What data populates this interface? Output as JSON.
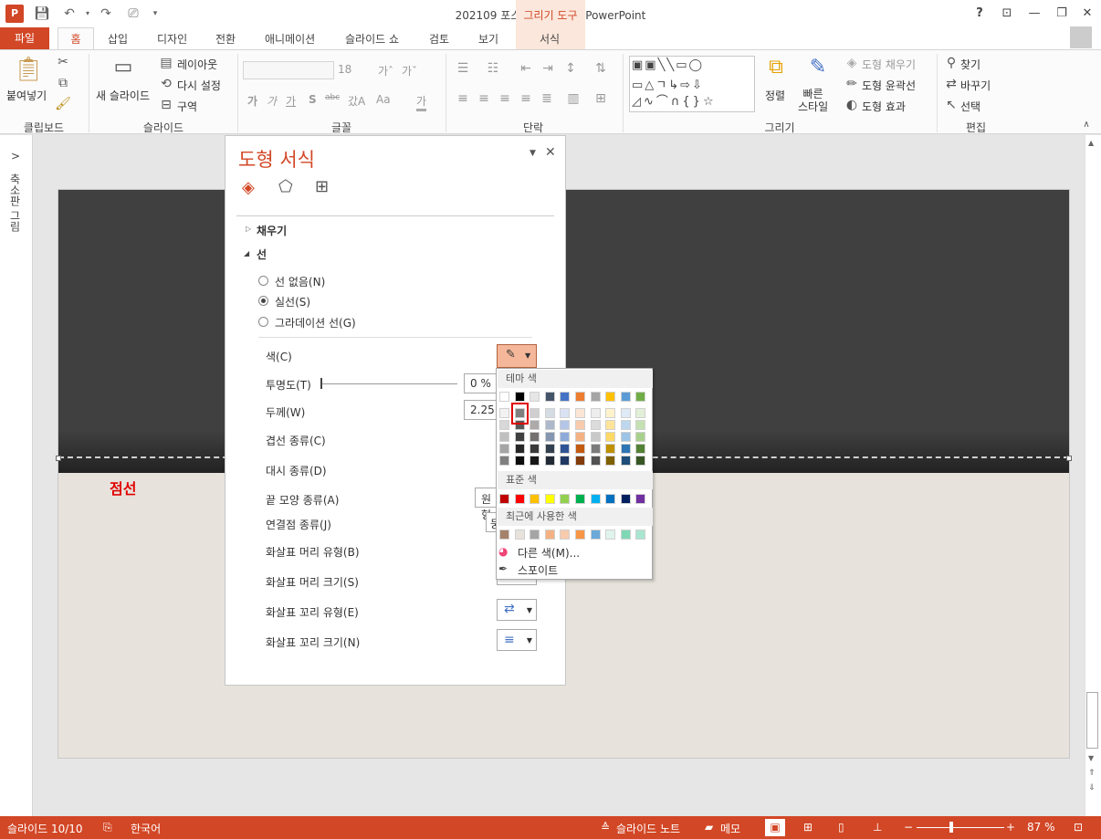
{
  "window": {
    "title": "202109 포스팅용 완성본 - PowerPoint",
    "context_tab_group": "그리기 도구",
    "help": "?",
    "minimize": "—",
    "restore": "❐",
    "close": "✕"
  },
  "tabs": {
    "file": "파일",
    "home": "홈",
    "insert": "삽입",
    "design": "디자인",
    "transitions": "전환",
    "animations": "애니메이션",
    "slideshow": "슬라이드 쇼",
    "review": "검토",
    "view": "보기",
    "format": "서식"
  },
  "ribbon": {
    "clipboard": {
      "paste": "붙여넣기",
      "group": "클립보드"
    },
    "slides": {
      "new_slide": "새 슬라이드",
      "layout": "레이아웃",
      "reset": "다시 설정",
      "section": "구역",
      "group": "슬라이드"
    },
    "font": {
      "size": "18",
      "group": "글꼴",
      "bold": "가",
      "italic": "가",
      "underline": "가",
      "shadow": "S",
      "strike": "abc",
      "spacing": "갔A",
      "case": "Aa",
      "color": "가"
    },
    "paragraph": {
      "group": "단락"
    },
    "drawing": {
      "arrange": "정렬",
      "quick_styles": "빠른\n스타일",
      "shape_fill": "도형 채우기",
      "shape_outline": "도형 윤곽선",
      "shape_effects": "도형 효과",
      "group": "그리기"
    },
    "editing": {
      "find": "찾기",
      "replace": "바꾸기",
      "select": "선택",
      "group": "편집"
    }
  },
  "left_panel": {
    "label": "축소판 그림",
    "expand": ">"
  },
  "slide": {
    "annotation": "점선"
  },
  "format_pane": {
    "title": "도형 서식",
    "fill_section": "채우기",
    "line_section": "선",
    "no_line": "선 없음(N)",
    "solid_line": "실선(S)",
    "gradient_line": "그라데이션 선(G)",
    "color_label": "색(C)",
    "transparency_label": "투명도(T)",
    "transparency_value": "0 %",
    "width_label": "두께(W)",
    "width_value": "2.25",
    "compound_label": "겹선 종류(C)",
    "dash_label": "대시 종류(D)",
    "cap_label": "끝 모양 종류(A)",
    "cap_value": "원형",
    "join_label": "연결점 종류(J)",
    "join_value": "둥",
    "begin_arrow_type": "화살표 머리 유형(B)",
    "begin_arrow_size": "화살표 머리 크기(S)",
    "end_arrow_type": "화살표 꼬리 유형(E)",
    "end_arrow_size": "화살표 꼬리 크기(N)"
  },
  "color_palette": {
    "theme_header": "테마 색",
    "standard_header": "표준 색",
    "recent_header": "최근에 사용한 색",
    "more_colors": "다른 색(M)...",
    "eyedropper": "스포이트",
    "theme_top": [
      "#ffffff",
      "#000000",
      "#e7e6e6",
      "#44546a",
      "#4472c4",
      "#ed7d31",
      "#a5a5a5",
      "#ffc000",
      "#5b9bd5",
      "#70ad47"
    ],
    "theme_shades": [
      [
        "#f2f2f2",
        "#7f7f7f",
        "#d0cece",
        "#d6dce4",
        "#d9e2f3",
        "#fbe5d5",
        "#ededed",
        "#fff2cc",
        "#deebf6",
        "#e2efd9"
      ],
      [
        "#d8d8d8",
        "#595959",
        "#aeaaaa",
        "#adb9ca",
        "#b4c6e7",
        "#f7cbac",
        "#dbdbdb",
        "#fee599",
        "#bdd7ee",
        "#c5e0b3"
      ],
      [
        "#bfbfbf",
        "#3f3f3f",
        "#757070",
        "#8496b0",
        "#8eaadb",
        "#f4b183",
        "#c9c9c9",
        "#ffd965",
        "#9dc3e6",
        "#a8d08d"
      ],
      [
        "#a5a5a5",
        "#262626",
        "#3a3838",
        "#323f4f",
        "#2f5496",
        "#c55a11",
        "#7b7b7b",
        "#bf9000",
        "#2e75b5",
        "#538135"
      ],
      [
        "#7f7f7f",
        "#0c0c0c",
        "#171616",
        "#222a35",
        "#1f3864",
        "#833c0b",
        "#525252",
        "#7f6000",
        "#1e4e79",
        "#375623"
      ]
    ],
    "standard": [
      "#c00000",
      "#ff0000",
      "#ffc000",
      "#ffff00",
      "#92d050",
      "#00b050",
      "#00b0f0",
      "#0070c0",
      "#002060",
      "#7030a0"
    ],
    "recent": [
      "#a5826a",
      "#e7e3dc",
      "#a5a5a5",
      "#f4b183",
      "#f8cbad",
      "#f79646",
      "#6aa9d8",
      "#dff4ec",
      "#7fd8b4",
      "#a9e5cf"
    ]
  },
  "statusbar": {
    "slide_info": "슬라이드 10/10",
    "language": "한국어",
    "notes": "슬라이드 노트",
    "comments": "메모",
    "zoom": "87 %"
  }
}
